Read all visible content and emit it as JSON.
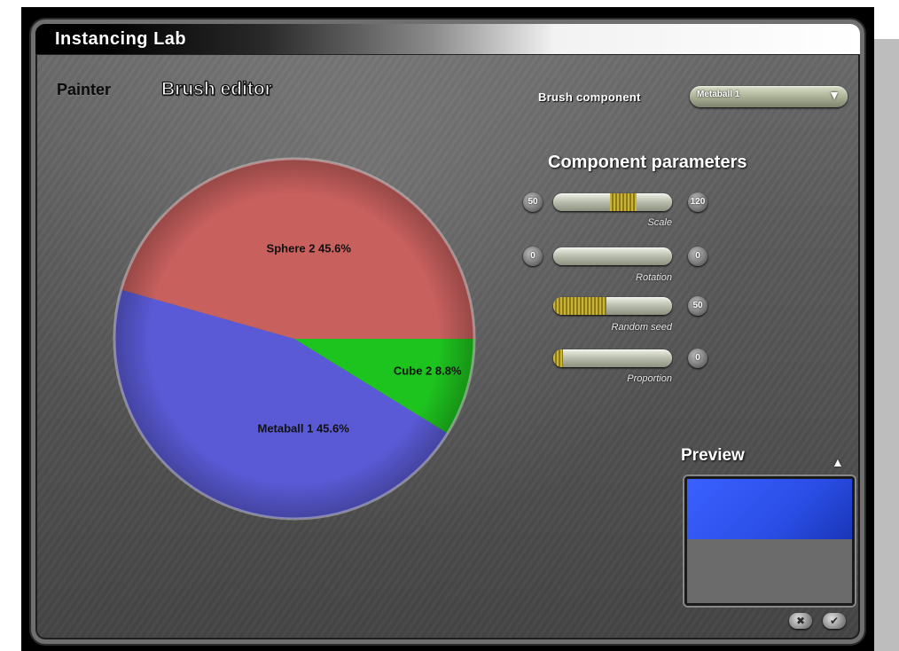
{
  "window": {
    "title": "Instancing Lab"
  },
  "tabs": [
    {
      "label": "Painter"
    },
    {
      "label": "Brush editor"
    }
  ],
  "brush_component": {
    "label": "Brush component",
    "value": "Metaball 1"
  },
  "params": {
    "title": "Component parameters",
    "sliders": [
      {
        "min_label": "50",
        "max_label": "120",
        "label": "Scale",
        "fraction": 0.55
      },
      {
        "min_label": "0",
        "max_label": "0",
        "label": "Rotation",
        "fraction": 0.0
      },
      {
        "min_label": "",
        "max_label": "50",
        "label": "Random seed",
        "fraction": 0.45
      },
      {
        "min_label": "",
        "max_label": "0",
        "label": "Proportion",
        "fraction": 0.08
      }
    ]
  },
  "chart_data": {
    "type": "pie",
    "slices": [
      {
        "label": "Sphere 2 45.6%",
        "value": 45.6,
        "color": "#c8605e"
      },
      {
        "label": "Metaball 1 45.6%",
        "value": 45.6,
        "color": "#5a5ad6"
      },
      {
        "label": "Cube 2 8.8%",
        "value": 8.8,
        "color": "#1ec41e"
      }
    ]
  },
  "preview": {
    "title": "Preview",
    "colors": {
      "top": "#2f55f0",
      "bottom": "#6b6b6b"
    }
  },
  "buttons": {
    "cancel_icon": "x-icon",
    "ok_icon": "checkmark-icon"
  }
}
